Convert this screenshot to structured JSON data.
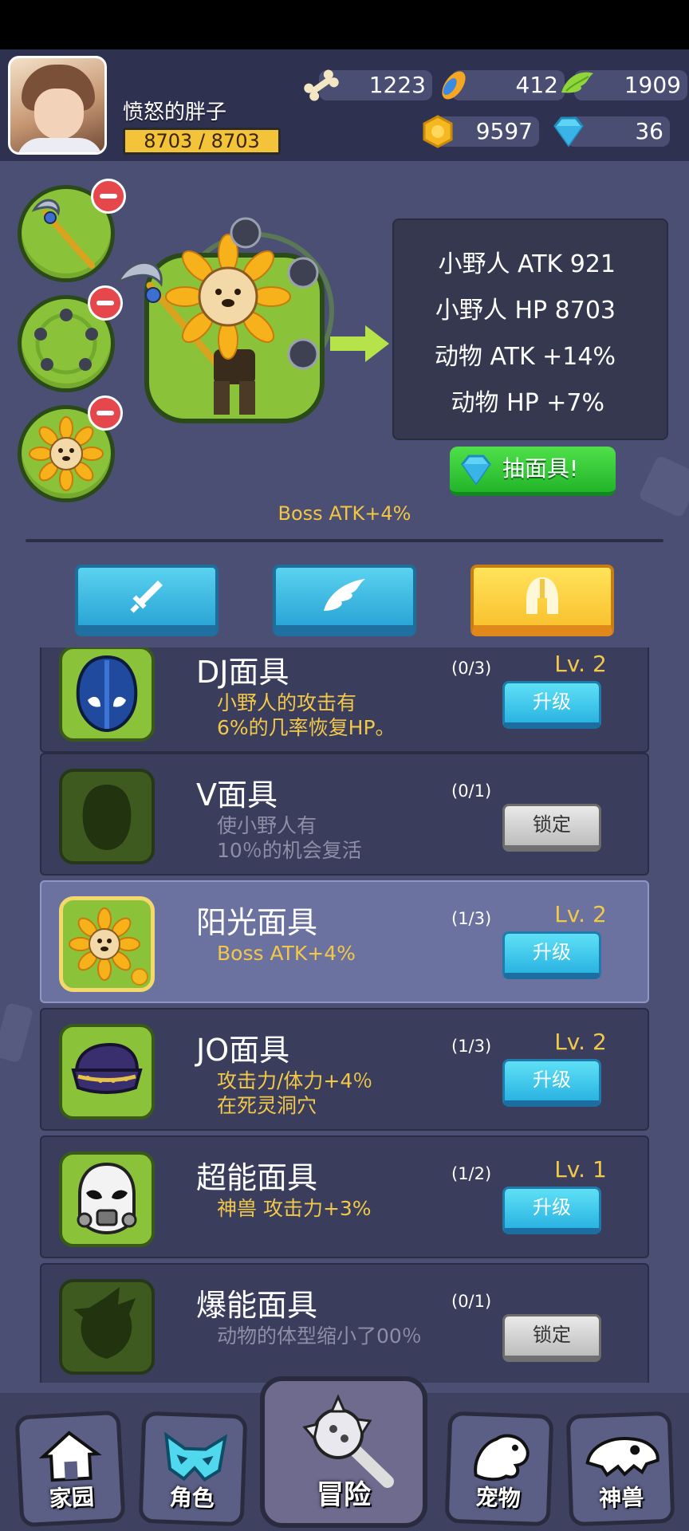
{
  "player": {
    "name": "愤怒的胖子",
    "hp": "8703 / 8703"
  },
  "resources": [
    {
      "icon": "bone-icon",
      "value": "1223"
    },
    {
      "icon": "feather-icon",
      "value": "412"
    },
    {
      "icon": "green-wing-icon",
      "value": "1909"
    },
    {
      "icon": "gold-coin-icon",
      "value": "9597"
    },
    {
      "icon": "diamond-icon",
      "value": "36"
    }
  ],
  "equipped_slots": [
    {
      "icon": "spear-icon"
    },
    {
      "icon": "shuriken-ring-icon"
    },
    {
      "icon": "sunflower-mask-icon"
    }
  ],
  "stats": [
    "小野人 ATK 921",
    "小野人 HP 8703",
    "动物 ATK +14%",
    "动物 HP +7%"
  ],
  "draw_button": "抽面具!",
  "bonus": "Boss ATK+4%",
  "tabs": [
    {
      "icon": "sword-icon",
      "active": false
    },
    {
      "icon": "wing-icon",
      "active": false
    },
    {
      "icon": "helmet-icon",
      "active": true
    }
  ],
  "masks": [
    {
      "name": "DJ面具",
      "desc": "小野人的攻击有\n6%的几率恢复HP。",
      "count": "(0/3)",
      "level": "Lv. 2",
      "action": "升级",
      "locked": false,
      "selected": false
    },
    {
      "name": "V面具",
      "desc": "使小野人有\n10％的机会复活",
      "count": "(0/1)",
      "level": "",
      "action": "锁定",
      "locked": true,
      "selected": false
    },
    {
      "name": "阳光面具",
      "desc": "Boss ATK+4%",
      "count": "(1/3)",
      "level": "Lv. 2",
      "action": "升级",
      "locked": false,
      "selected": true
    },
    {
      "name": "JO面具",
      "desc": "攻击力/体力+4％\n在死灵洞穴",
      "count": "(1/3)",
      "level": "Lv. 2",
      "action": "升级",
      "locked": false,
      "selected": false
    },
    {
      "name": "超能面具",
      "desc": "神兽 攻击力+3%",
      "count": "(1/2)",
      "level": "Lv. 1",
      "action": "升级",
      "locked": false,
      "selected": false
    },
    {
      "name": "爆能面具",
      "desc": "动物的体型缩小了00％",
      "count": "(0/1)",
      "level": "",
      "action": "锁定",
      "locked": true,
      "selected": false
    }
  ],
  "nav": [
    {
      "label": "家园",
      "icon": "home-icon"
    },
    {
      "label": "角色",
      "icon": "mask-icon"
    },
    {
      "label": "冒险",
      "icon": "adventure-club-icon"
    },
    {
      "label": "宠物",
      "icon": "pet-icon"
    },
    {
      "label": "神兽",
      "icon": "dino-skull-icon"
    }
  ],
  "colors": {
    "accent_gold": "#f2c84a",
    "panel": "#4b4f73",
    "card": "#3a3d5c",
    "upgrade_blue": "#2bb4e2",
    "draw_green": "#22b52a"
  }
}
